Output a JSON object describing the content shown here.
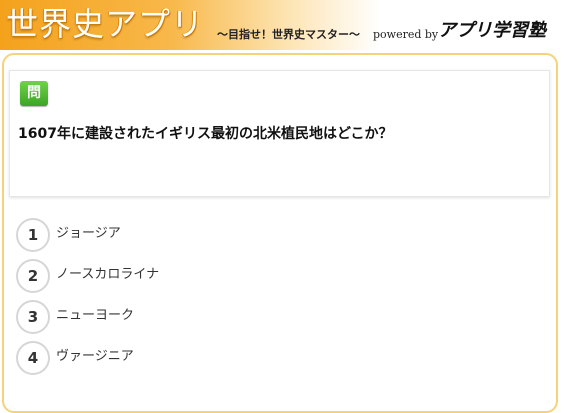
{
  "header": {
    "app_title": "世界史アプリ",
    "tagline": "～目指せ！世界史マスター～",
    "powered_by": "powered by",
    "brand": "アプリ学習塾",
    "accent_color": "#f4a21c"
  },
  "question": {
    "badge": "問",
    "badge_color": "#4cb82f",
    "text": "1607年に建設されたイギリス最初の北米植民地はどこか？"
  },
  "choices": [
    {
      "number": "1",
      "label": "ジョージア"
    },
    {
      "number": "2",
      "label": "ノースカロライナ"
    },
    {
      "number": "3",
      "label": "ニューヨーク"
    },
    {
      "number": "4",
      "label": "ヴァージニア"
    }
  ]
}
